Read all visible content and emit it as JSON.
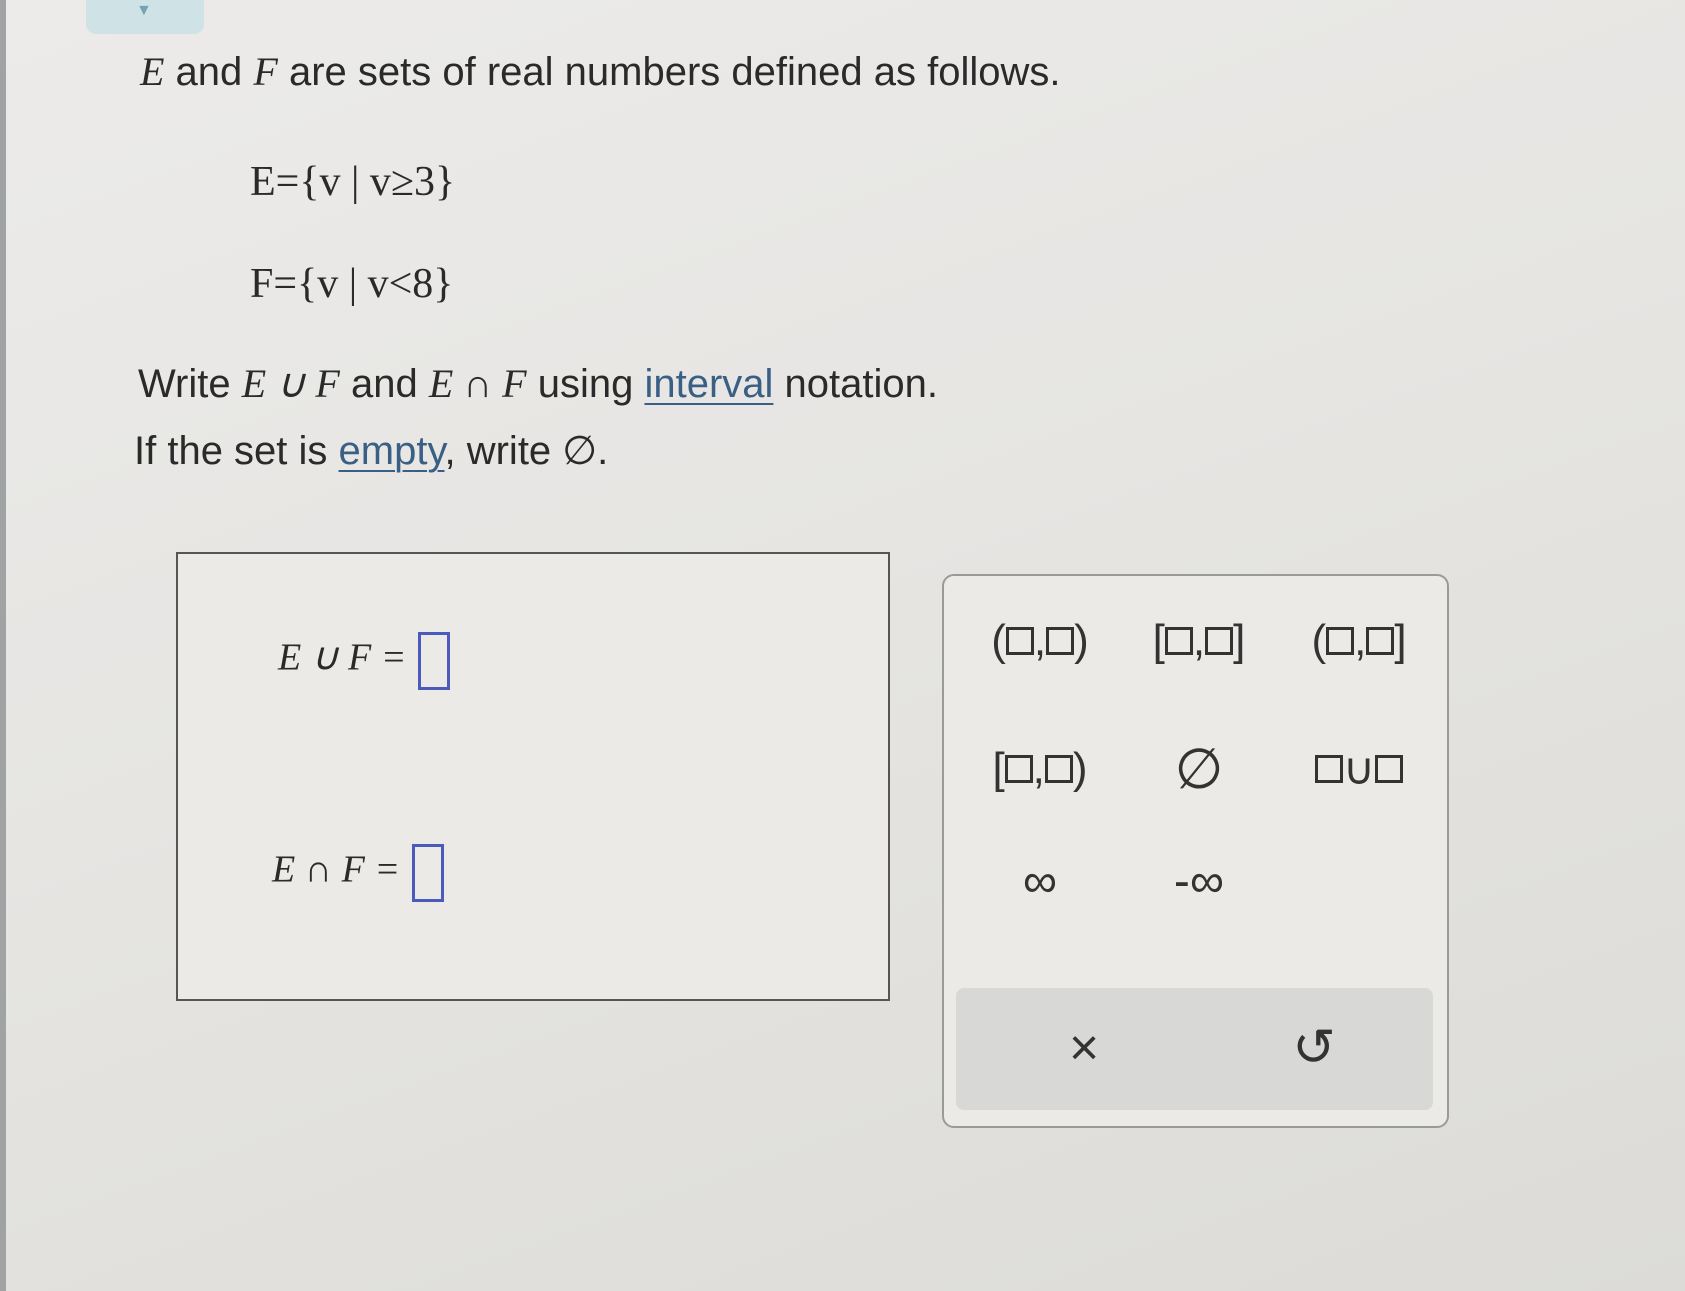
{
  "intro": {
    "set_e": "E",
    "mid1": " and ",
    "set_f": "F",
    "rest": " are sets of real numbers defined as follows."
  },
  "definitions": {
    "e_def": "E={v | v≥3}",
    "f_def": "F={v | v<8}"
  },
  "instruction": {
    "word_write": "Write ",
    "union_expr": "E ∪ F",
    "word_and": " and ",
    "intersection_expr": "E ∩ F",
    "word_using": " using ",
    "link_interval": "interval",
    "word_notation": " notation.",
    "empty_prefix": "If the set is ",
    "link_empty": "empty",
    "empty_suffix": ", write ∅."
  },
  "answers": {
    "union_label": "E ∪ F =",
    "intersection_label": "E ∩ F ="
  },
  "keypad": {
    "open_open": [
      "(",
      ",",
      ")"
    ],
    "closed_closed": [
      "[",
      ",",
      "]"
    ],
    "open_closed": [
      "(",
      ",",
      "]"
    ],
    "closed_open": [
      "[",
      ",",
      ")"
    ],
    "empty_set": "∅",
    "union": "∪",
    "infinity": "∞",
    "neg_infinity": "-∞",
    "clear": "×",
    "undo": "↺"
  },
  "colors": {
    "link": "#3a5f85",
    "input_border": "#4a5bbd",
    "tab": "#cfe2e6"
  }
}
